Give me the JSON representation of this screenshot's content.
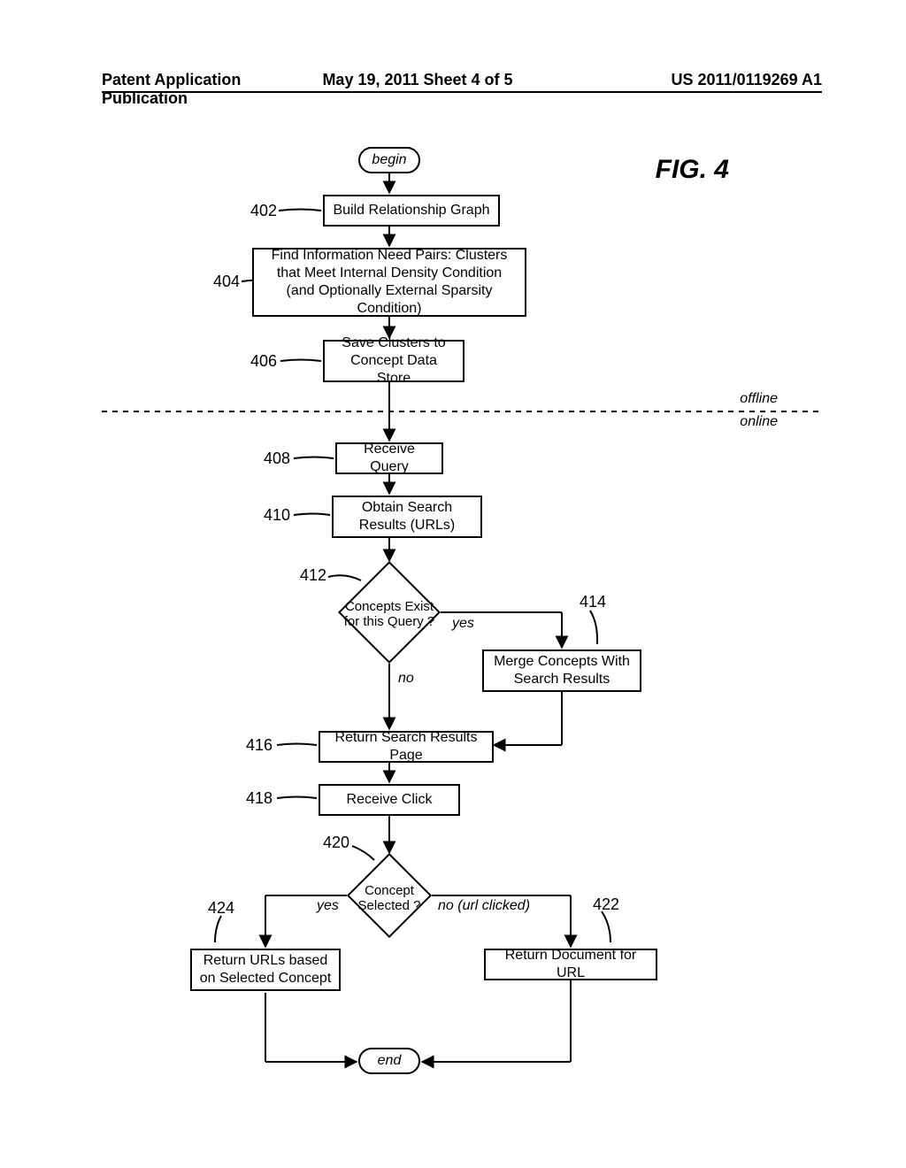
{
  "header": {
    "left": "Patent Application Publication",
    "center": "May 19, 2011  Sheet 4 of 5",
    "right": "US 2011/0119269 A1"
  },
  "figure_label": "FIG. 4",
  "mode": {
    "offline": "offline",
    "online": "online"
  },
  "terminators": {
    "begin": "begin",
    "end": "end"
  },
  "steps": {
    "s402": {
      "ref": "402",
      "text": "Build Relationship Graph"
    },
    "s404": {
      "ref": "404",
      "text": "Find Information Need Pairs: Clusters that Meet Internal Density Condition (and Optionally External Sparsity Condition)"
    },
    "s406": {
      "ref": "406",
      "text": "Save Clusters to Concept Data Store"
    },
    "s408": {
      "ref": "408",
      "text": "Receive Query"
    },
    "s410": {
      "ref": "410",
      "text": "Obtain Search Results (URLs)"
    },
    "s412": {
      "ref": "412",
      "text": "Concepts Exist for this Query ?"
    },
    "s414": {
      "ref": "414",
      "text": "Merge Concepts With Search Results"
    },
    "s416": {
      "ref": "416",
      "text": "Return Search Results Page"
    },
    "s418": {
      "ref": "418",
      "text": "Receive Click"
    },
    "s420": {
      "ref": "420",
      "text": "Concept Selected ?"
    },
    "s422": {
      "ref": "422",
      "text": "Return Document for URL"
    },
    "s424": {
      "ref": "424",
      "text": "Return URLs based on Selected Concept"
    }
  },
  "edge_labels": {
    "d412_yes": "yes",
    "d412_no": "no",
    "d420_yes": "yes",
    "d420_no": "no (url clicked)"
  }
}
